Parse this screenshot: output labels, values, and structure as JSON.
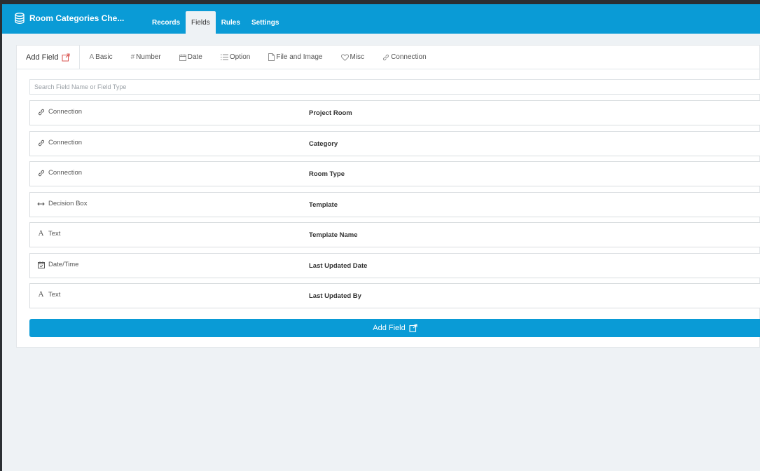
{
  "app": {
    "title": "Room Categories Che..."
  },
  "nav": {
    "tabs": [
      {
        "label": "Records"
      },
      {
        "label": "Fields"
      },
      {
        "label": "Rules"
      },
      {
        "label": "Settings"
      }
    ],
    "active": "Fields"
  },
  "toolbar": {
    "add_field": "Add Field",
    "types": [
      {
        "label": "Basic",
        "icon": "text-icon"
      },
      {
        "label": "Number",
        "icon": "hash-icon"
      },
      {
        "label": "Date",
        "icon": "calendar-icon"
      },
      {
        "label": "Option",
        "icon": "list-icon"
      },
      {
        "label": "File and Image",
        "icon": "file-icon"
      },
      {
        "label": "Misc",
        "icon": "heart-icon"
      },
      {
        "label": "Connection",
        "icon": "link-icon"
      }
    ]
  },
  "search": {
    "placeholder": "Search Field Name or Field Type",
    "value": ""
  },
  "fields": [
    {
      "type": "Connection",
      "icon": "link-icon",
      "name": "Project Room"
    },
    {
      "type": "Connection",
      "icon": "link-icon",
      "name": "Category"
    },
    {
      "type": "Connection",
      "icon": "link-icon",
      "name": "Room Type"
    },
    {
      "type": "Decision Box",
      "icon": "arrows-horizontal-icon",
      "name": "Template"
    },
    {
      "type": "Text",
      "icon": "text-icon",
      "name": "Template Name"
    },
    {
      "type": "Date/Time",
      "icon": "calendar-check-icon",
      "name": "Last Updated Date"
    },
    {
      "type": "Text",
      "icon": "text-icon",
      "name": "Last Updated By"
    }
  ],
  "add_button": {
    "label": "Add Field"
  },
  "colors": {
    "header": "#0a9bd6",
    "background": "#eef2f5",
    "accent": "#0a9bd6"
  }
}
